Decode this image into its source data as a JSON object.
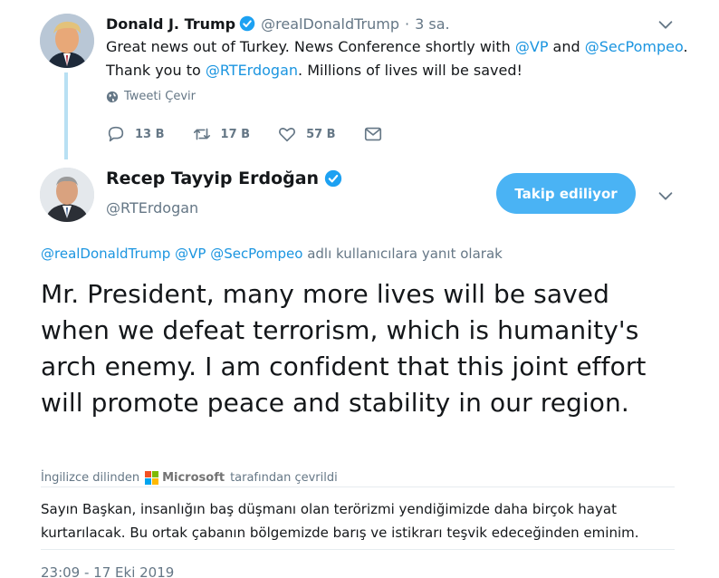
{
  "parent": {
    "name": "Donald J. Trump",
    "handle": "@realDonaldTrump",
    "dot": "·",
    "time": "3 sa.",
    "text_parts": [
      "Great news out of Turkey. News Conference shortly with ",
      "@VP",
      " and ",
      "@SecPompeo",
      ".",
      "Thank you to ",
      "@RTErdogan",
      ". Millions of lives will be saved!"
    ],
    "translate_label": "Tweeti Çevir",
    "actions": {
      "reply_count": "13 B",
      "retweet_count": "17 B",
      "like_count": "57 B"
    }
  },
  "reply": {
    "name": "Recep Tayyip Erdoğan",
    "handle": "@RTErdogan",
    "follow_label": "Takip ediliyor",
    "reply_to": {
      "mentions": [
        "@realDonaldTrump",
        "@VP",
        "@SecPompeo"
      ],
      "suffix": "adlı kullanıcılara yanıt olarak"
    },
    "text": "Mr. President, many more lives will be saved when we defeat terrorism, which is humanity's arch enemy. I am confident that this joint effort will promote peace and stability in our region.",
    "translation_note": {
      "prefix": "İngilizce dilinden",
      "provider": "Microsoft",
      "suffix": "tarafından çevrildi"
    },
    "translation": "Sayın Başkan, insanlığın baş düşmanı olan terörizmi yendiğimizde daha birçok hayat kurtarılacak. Bu ortak çabanın bölgemizde barış ve istikrarı teşvik edeceğinden eminim.",
    "timestamp": "23:09 - 17 Eki 2019"
  },
  "colors": {
    "link": "#1b95e0",
    "muted": "#657786",
    "follow_button": "#4ab3f4",
    "thread_line": "#b8e0f3",
    "verified": "#1da1f2"
  }
}
